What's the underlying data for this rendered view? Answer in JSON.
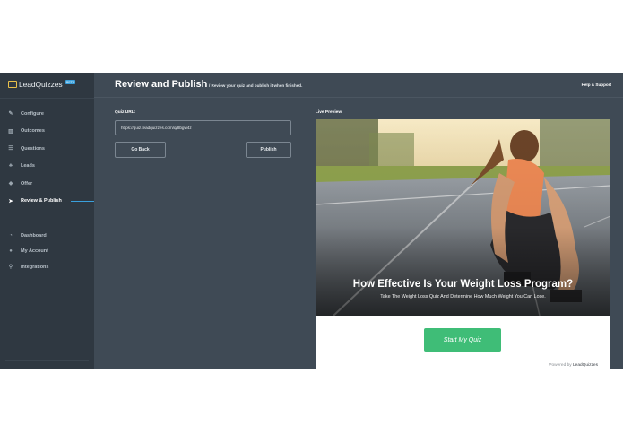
{
  "app": {
    "logo": {
      "name_bold": "Lead",
      "name_rest": "Quizzes",
      "badge": "BETA"
    }
  },
  "sidebar": {
    "items": [
      {
        "label": "Configure",
        "icon": "pencil-icon"
      },
      {
        "label": "Outcomes",
        "icon": "bar-chart-icon"
      },
      {
        "label": "Questions",
        "icon": "list-icon"
      },
      {
        "label": "Leads",
        "icon": "users-icon"
      },
      {
        "label": "Offer",
        "icon": "tag-icon"
      },
      {
        "label": "Review & Publish",
        "icon": "send-icon",
        "active": true
      }
    ],
    "items2": [
      {
        "label": "Dashboard",
        "icon": "gauge-icon"
      },
      {
        "label": "My Account",
        "icon": "user-icon"
      },
      {
        "label": "Integrations",
        "icon": "plug-icon"
      }
    ]
  },
  "header": {
    "title": "Review and Publish",
    "subtitle": "/ Review your quiz and publish it when finished.",
    "help": "Help & Support"
  },
  "main": {
    "url_label": "Quiz URL:",
    "url_value": "https://quiz.leadquizzes.com/q/8bgw4z",
    "back_label": "Go Back",
    "publish_label": "Publish",
    "live_preview_label": "Live Preview"
  },
  "preview": {
    "title": "How Effective Is Your Weight Loss Program?",
    "subtitle": "Take The Weight Loss Quiz And Determine How Much Weight You Can Lose.",
    "cta": "Start My Quiz",
    "powered_prefix": "Powered by",
    "powered_brand": "LeadQuizzes"
  },
  "colors": {
    "sidebar_bg": "#2f3841",
    "main_bg": "#3f4a55",
    "accent": "#3aa0dc",
    "cta_green": "#3fbd77"
  }
}
